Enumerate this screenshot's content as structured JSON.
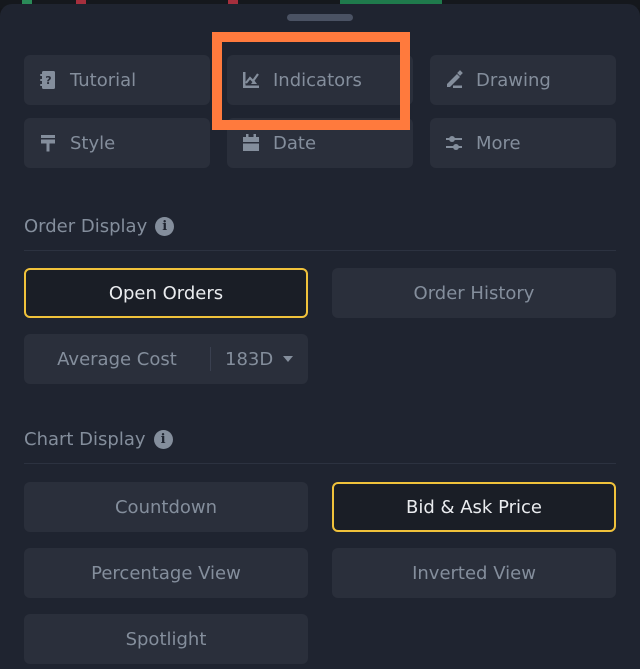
{
  "toolbar": {
    "items": [
      {
        "label": "Tutorial",
        "icon": "tutorial-book-icon"
      },
      {
        "label": "Indicators",
        "icon": "indicators-chart-icon"
      },
      {
        "label": "Drawing",
        "icon": "drawing-pen-icon"
      },
      {
        "label": "Style",
        "icon": "style-brush-icon"
      },
      {
        "label": "Date",
        "icon": "calendar-icon"
      },
      {
        "label": "More",
        "icon": "sliders-icon"
      }
    ],
    "highlighted": "Indicators"
  },
  "order_display": {
    "title": "Order Display",
    "info_glyph": "i",
    "options": [
      {
        "label": "Open Orders",
        "selected": true
      },
      {
        "label": "Order History",
        "selected": false
      }
    ],
    "average_cost": {
      "label": "Average Cost",
      "period": "183D"
    }
  },
  "chart_display": {
    "title": "Chart Display",
    "info_glyph": "i",
    "options": [
      {
        "label": "Countdown",
        "selected": false
      },
      {
        "label": "Bid & Ask Price",
        "selected": true
      },
      {
        "label": "Percentage View",
        "selected": false
      },
      {
        "label": "Inverted View",
        "selected": false
      },
      {
        "label": "Spotlight",
        "selected": false
      }
    ]
  },
  "colors": {
    "sheet_bg": "#1f2430",
    "button_bg": "#2a2f3b",
    "text_muted": "#848e9c",
    "text_active": "#eaecef",
    "selected_border": "#f0c23b",
    "annotation_orange": "#ff7a3d"
  }
}
